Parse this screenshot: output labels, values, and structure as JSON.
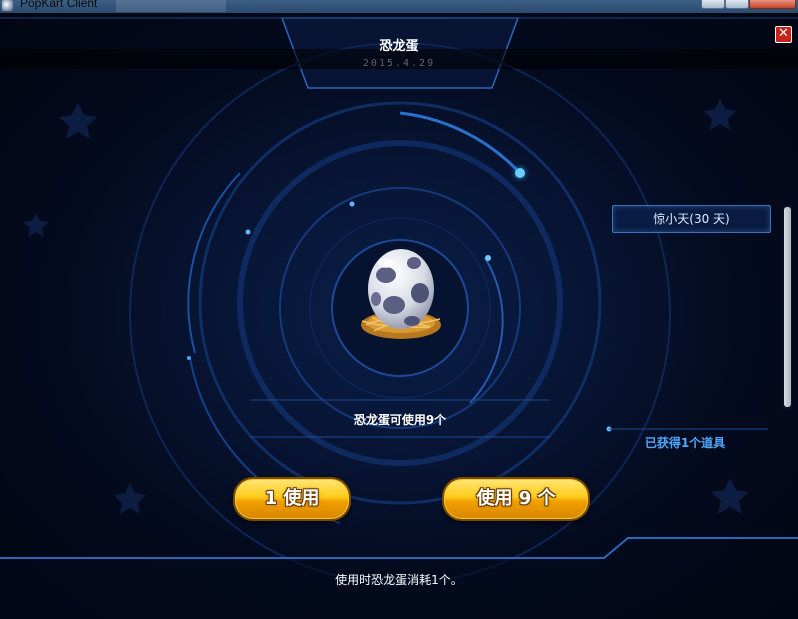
{
  "window": {
    "title": "PopKart Client"
  },
  "dialog": {
    "item_name": "恐龙蛋",
    "date": "2015.4.29",
    "close_label": "✕",
    "usable_text": "恐龙蛋可使用9个",
    "reward_item": "惊小天(30 天)",
    "acquired_text": "已获得1个道具",
    "use_one_label": "1 使用",
    "use_all_label": "使用 9 个",
    "consume_note": "使用时恐龙蛋消耗1个。"
  },
  "colors": {
    "accent_gold": "#ffcc1a",
    "accent_blue": "#4fa8ff",
    "close_red": "#c8231a"
  },
  "icons": {
    "item_image": "dinosaur-egg-in-nest-icon",
    "close": "close-icon",
    "app": "popkart-app-icon"
  }
}
